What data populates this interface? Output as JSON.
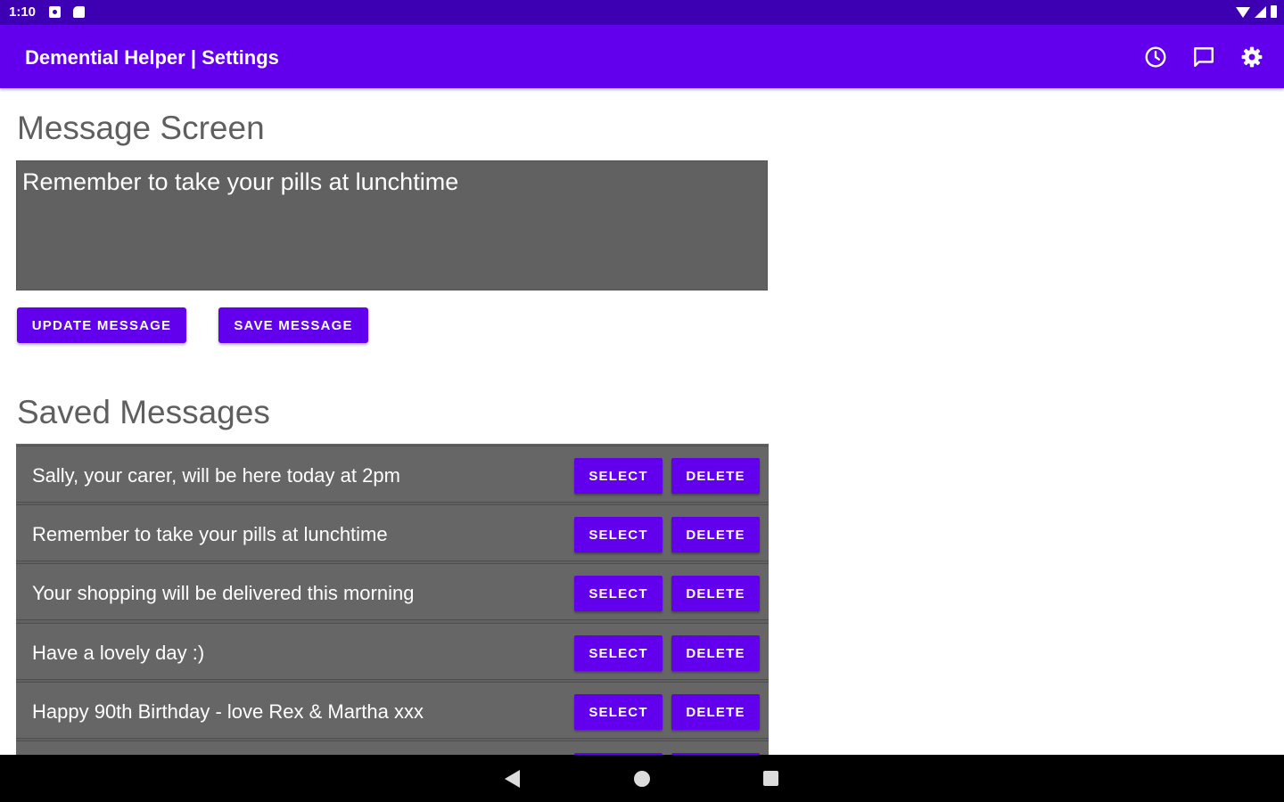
{
  "status_bar": {
    "time": "1:10",
    "icons": [
      "notification-icon",
      "sd-card-icon",
      "wifi-icon",
      "signal-icon",
      "battery-icon"
    ]
  },
  "app_bar": {
    "title": "Demential Helper | Settings",
    "actions": [
      "clock-icon",
      "message-icon",
      "settings-icon"
    ]
  },
  "message_screen": {
    "title": "Message Screen",
    "current_message": "Remember to take your pills at lunchtime",
    "update_label": "UPDATE MESSAGE",
    "save_label": "SAVE MESSAGE"
  },
  "saved_messages": {
    "title": "Saved Messages",
    "select_label": "SELECT",
    "delete_label": "DELETE",
    "items": [
      {
        "text": "Sally, your carer, will be here today at 2pm"
      },
      {
        "text": "Remember to take your pills at lunchtime"
      },
      {
        "text": "Your shopping will be delivered this morning"
      },
      {
        "text": "Have a lovely day :)"
      },
      {
        "text": "Happy 90th Birthday - love Rex & Martha xxx"
      },
      {
        "text": ""
      }
    ]
  },
  "colors": {
    "status_bar": "#3d00b3",
    "accent": "#6200ee",
    "box_bg": "#616161"
  }
}
